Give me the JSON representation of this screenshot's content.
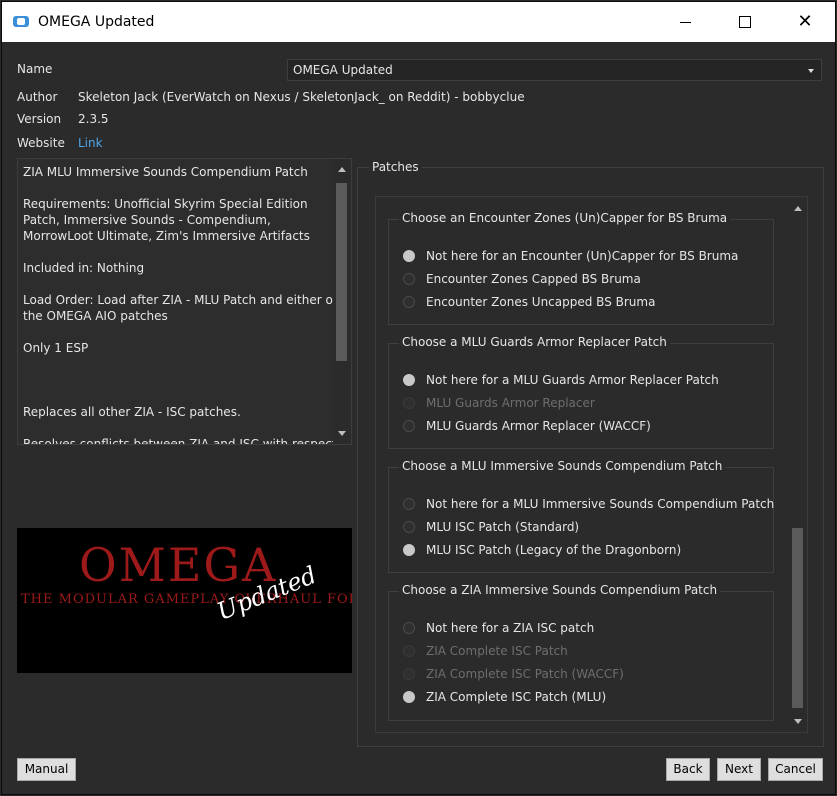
{
  "window": {
    "title": "OMEGA Updated",
    "icon": "app-icon",
    "minimize_icon": "minimize-icon",
    "maximize_icon": "maximize-icon",
    "close_glyph": "✕"
  },
  "info": {
    "name_label": "Name",
    "name_value": "OMEGA Updated",
    "author_label": "Author",
    "author_value": "Skeleton Jack (EverWatch on Nexus / SkeletonJack_ on Reddit) - bobbyclue",
    "version_label": "Version",
    "version_value": "2.3.5",
    "website_label": "Website",
    "website_link": "Link"
  },
  "description": {
    "lines": [
      "ZIA MLU Immersive Sounds Compendium Patch",
      "",
      "Requirements: Unofficial Skyrim Special Edition",
      "Patch, Immersive Sounds - Compendium,",
      "MorrowLoot Ultimate, Zim's Immersive Artifacts",
      "",
      "Included in: Nothing",
      "",
      "Load Order: Load after ZIA - MLU Patch and either of",
      "the OMEGA AIO patches",
      "",
      "Only 1 ESP",
      "",
      "",
      "",
      "Replaces all other ZIA - ISC patches.",
      "",
      "Resolves conflicts between ZIA and ISC with respect"
    ]
  },
  "image": {
    "title": "OMEGA",
    "subtitle": "THE MODULAR GAMEPLAY OVERHAUL FOR SSE",
    "overlay": "Updated"
  },
  "patches": {
    "title": "Patches",
    "groups": [
      {
        "title": "Choose an Encounter Zones (Un)Capper for BS Bruma",
        "options": [
          {
            "label": "Not here for an Encounter (Un)Capper for BS Bruma",
            "checked": true,
            "disabled": false
          },
          {
            "label": "Encounter Zones Capped BS Bruma",
            "checked": false,
            "disabled": false
          },
          {
            "label": "Encounter Zones Uncapped BS Bruma",
            "checked": false,
            "disabled": false
          }
        ]
      },
      {
        "title": "Choose a MLU Guards Armor Replacer Patch",
        "options": [
          {
            "label": "Not here for a MLU Guards Armor Replacer Patch",
            "checked": true,
            "disabled": false
          },
          {
            "label": "MLU Guards Armor Replacer",
            "checked": false,
            "disabled": true
          },
          {
            "label": "MLU Guards Armor Replacer (WACCF)",
            "checked": false,
            "disabled": false
          }
        ]
      },
      {
        "title": "Choose a MLU Immersive Sounds Compendium Patch",
        "options": [
          {
            "label": "Not here for a MLU Immersive Sounds Compendium Patch",
            "checked": false,
            "disabled": false
          },
          {
            "label": "MLU ISC Patch (Standard)",
            "checked": false,
            "disabled": false
          },
          {
            "label": "MLU ISC Patch (Legacy of the Dragonborn)",
            "checked": true,
            "disabled": false
          }
        ]
      },
      {
        "title": "Choose a ZIA Immersive Sounds Compendium Patch",
        "options": [
          {
            "label": "Not here for a ZIA ISC patch",
            "checked": false,
            "disabled": false
          },
          {
            "label": "ZIA Complete ISC Patch",
            "checked": false,
            "disabled": true
          },
          {
            "label": "ZIA Complete ISC Patch (WACCF)",
            "checked": false,
            "disabled": true
          },
          {
            "label": "ZIA Complete ISC Patch (MLU)",
            "checked": true,
            "disabled": false
          }
        ]
      }
    ]
  },
  "buttons": {
    "manual": "Manual",
    "back": "Back",
    "next": "Next",
    "cancel": "Cancel"
  }
}
